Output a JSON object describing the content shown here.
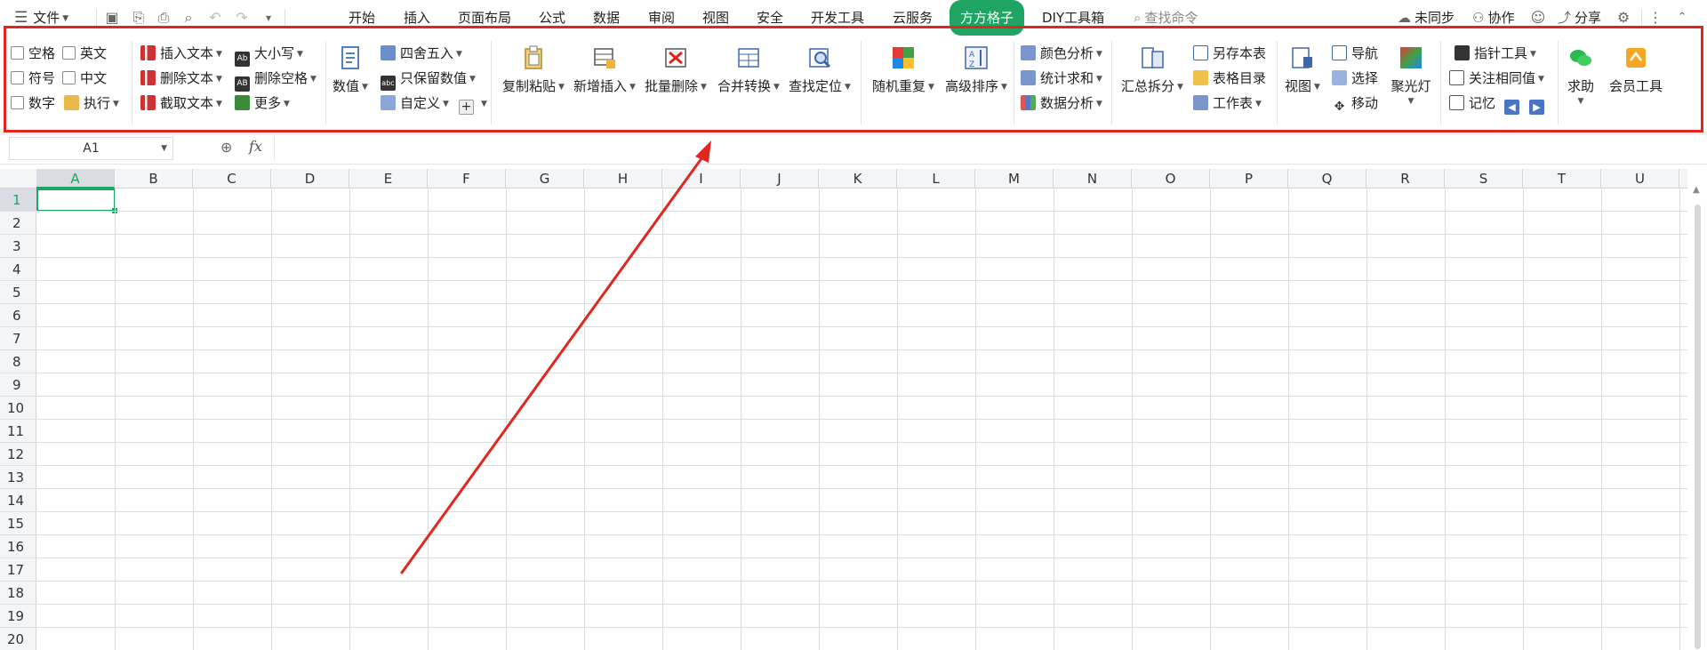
{
  "colors": {
    "accent": "#1fa463",
    "highlight": "#e0261f"
  },
  "menubar": {
    "file": "文件",
    "tabs": [
      "开始",
      "插入",
      "页面布局",
      "公式",
      "数据",
      "审阅",
      "视图",
      "安全",
      "开发工具",
      "云服务",
      "方方格子",
      "DIY工具箱"
    ],
    "active_tab": "方方格子",
    "search_placeholder": "查找命令",
    "sync": "未同步",
    "collab": "协作",
    "share": "分享"
  },
  "ribbon": {
    "checkboxes": [
      "空格",
      "英文",
      "符号",
      "中文",
      "数字"
    ],
    "execute": "执行",
    "text_ops": [
      "插入文本",
      "删除文本",
      "截取文本"
    ],
    "case_ops": [
      "大小写",
      "删除空格",
      "更多"
    ],
    "value": "数值",
    "round_ops": [
      "四舍五入",
      "只保留数值",
      "自定义"
    ],
    "big_buttons_1": [
      "复制粘贴",
      "新增插入",
      "批量删除",
      "合并转换",
      "查找定位"
    ],
    "big_buttons_2": [
      "随机重复",
      "高级排序"
    ],
    "analysis": [
      "颜色分析",
      "统计求和",
      "数据分析"
    ],
    "summary_split": "汇总拆分",
    "sheet_ops": [
      "另存本表",
      "表格目录",
      "工作表"
    ],
    "view": "视图",
    "nav_ops": [
      "导航",
      "选择",
      "移动"
    ],
    "spotlight": "聚光灯",
    "pointer_ops": [
      "指针工具",
      "关注相同值",
      "记忆"
    ],
    "help": "求助",
    "member": "会员工具"
  },
  "formula": {
    "namebox": "A1",
    "fx": "fx",
    "value": ""
  },
  "grid": {
    "columns": [
      "A",
      "B",
      "C",
      "D",
      "E",
      "F",
      "G",
      "H",
      "I",
      "J",
      "K",
      "L",
      "M",
      "N",
      "O",
      "P",
      "Q",
      "R",
      "S",
      "T",
      "U"
    ],
    "rows": [
      "1",
      "2",
      "3",
      "4",
      "5",
      "6",
      "7",
      "8",
      "9",
      "10",
      "11",
      "12",
      "13",
      "14",
      "15",
      "16",
      "17",
      "18",
      "19",
      "20"
    ],
    "active_cell": "A1"
  }
}
